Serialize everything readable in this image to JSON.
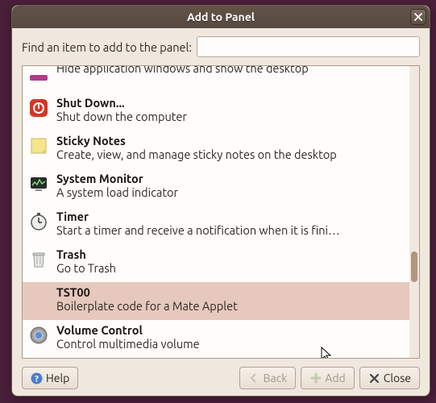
{
  "window": {
    "title": "Add to Panel"
  },
  "search": {
    "label": "Find an item to add to the panel:",
    "value": ""
  },
  "items": [
    {
      "title": "",
      "desc": "Hide application windows and show the desktop",
      "icon": "show-desktop"
    },
    {
      "title": "Shut Down...",
      "desc": "Shut down the computer",
      "icon": "shutdown"
    },
    {
      "title": "Sticky Notes",
      "desc": "Create, view, and manage sticky notes on the desktop",
      "icon": "sticky-notes"
    },
    {
      "title": "System Monitor",
      "desc": "A system load indicator",
      "icon": "system-monitor"
    },
    {
      "title": "Timer",
      "desc": "Start a timer and receive a notification when it is fini…",
      "icon": "timer"
    },
    {
      "title": "Trash",
      "desc": "Go to Trash",
      "icon": "trash"
    },
    {
      "title": "TST00",
      "desc": "Boilerplate code for a Mate Applet",
      "icon": "generic"
    },
    {
      "title": "Volume Control",
      "desc": "Control multimedia volume",
      "icon": "volume"
    }
  ],
  "buttons": {
    "help": "Help",
    "back": "Back",
    "add": "Add",
    "close": "Close"
  }
}
